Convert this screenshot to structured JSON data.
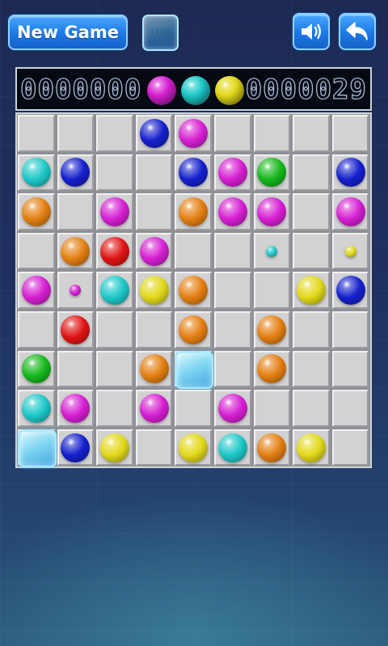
{
  "header": {
    "new_game_label": "New Game",
    "counter_text": "17/35",
    "sound_icon": "speaker-icon",
    "undo_icon": "undo-arrow-icon"
  },
  "scores": {
    "left": "0000000",
    "right": "0000029"
  },
  "next_balls": [
    "magenta",
    "cyan",
    "yellow"
  ],
  "colors": {
    "magenta": "#d61fd2",
    "cyan": "#1fc8c8",
    "yellow": "#e2d81a",
    "blue": "#1420cc",
    "green": "#16b81c",
    "orange": "#e47f12",
    "red": "#e01414"
  },
  "board": {
    "rows": 9,
    "cols": 9,
    "pieces": [
      {
        "r": 0,
        "c": 3,
        "color": "blue"
      },
      {
        "r": 0,
        "c": 4,
        "color": "magenta"
      },
      {
        "r": 1,
        "c": 0,
        "color": "cyan"
      },
      {
        "r": 1,
        "c": 1,
        "color": "blue"
      },
      {
        "r": 1,
        "c": 4,
        "color": "blue"
      },
      {
        "r": 1,
        "c": 5,
        "color": "magenta"
      },
      {
        "r": 1,
        "c": 6,
        "color": "green"
      },
      {
        "r": 1,
        "c": 8,
        "color": "blue"
      },
      {
        "r": 2,
        "c": 0,
        "color": "orange"
      },
      {
        "r": 2,
        "c": 2,
        "color": "magenta"
      },
      {
        "r": 2,
        "c": 4,
        "color": "orange"
      },
      {
        "r": 2,
        "c": 5,
        "color": "magenta"
      },
      {
        "r": 2,
        "c": 6,
        "color": "magenta"
      },
      {
        "r": 2,
        "c": 8,
        "color": "magenta"
      },
      {
        "r": 3,
        "c": 1,
        "color": "orange"
      },
      {
        "r": 3,
        "c": 2,
        "color": "red"
      },
      {
        "r": 3,
        "c": 3,
        "color": "magenta"
      },
      {
        "r": 3,
        "c": 6,
        "color": "cyan",
        "small": true
      },
      {
        "r": 3,
        "c": 8,
        "color": "yellow",
        "small": true
      },
      {
        "r": 4,
        "c": 0,
        "color": "magenta"
      },
      {
        "r": 4,
        "c": 1,
        "color": "magenta",
        "small": true
      },
      {
        "r": 4,
        "c": 2,
        "color": "cyan"
      },
      {
        "r": 4,
        "c": 3,
        "color": "yellow"
      },
      {
        "r": 4,
        "c": 4,
        "color": "orange"
      },
      {
        "r": 4,
        "c": 7,
        "color": "yellow"
      },
      {
        "r": 4,
        "c": 8,
        "color": "blue"
      },
      {
        "r": 5,
        "c": 1,
        "color": "red"
      },
      {
        "r": 5,
        "c": 4,
        "color": "orange"
      },
      {
        "r": 5,
        "c": 6,
        "color": "orange"
      },
      {
        "r": 6,
        "c": 0,
        "color": "green"
      },
      {
        "r": 6,
        "c": 3,
        "color": "orange"
      },
      {
        "r": 6,
        "c": 4,
        "color": "ice"
      },
      {
        "r": 6,
        "c": 6,
        "color": "orange"
      },
      {
        "r": 7,
        "c": 0,
        "color": "cyan"
      },
      {
        "r": 7,
        "c": 1,
        "color": "magenta"
      },
      {
        "r": 7,
        "c": 3,
        "color": "magenta"
      },
      {
        "r": 7,
        "c": 5,
        "color": "magenta"
      },
      {
        "r": 8,
        "c": 0,
        "color": "ice"
      },
      {
        "r": 8,
        "c": 1,
        "color": "blue"
      },
      {
        "r": 8,
        "c": 2,
        "color": "yellow"
      },
      {
        "r": 8,
        "c": 4,
        "color": "yellow"
      },
      {
        "r": 8,
        "c": 5,
        "color": "cyan"
      },
      {
        "r": 8,
        "c": 6,
        "color": "orange"
      },
      {
        "r": 8,
        "c": 7,
        "color": "yellow"
      }
    ]
  }
}
